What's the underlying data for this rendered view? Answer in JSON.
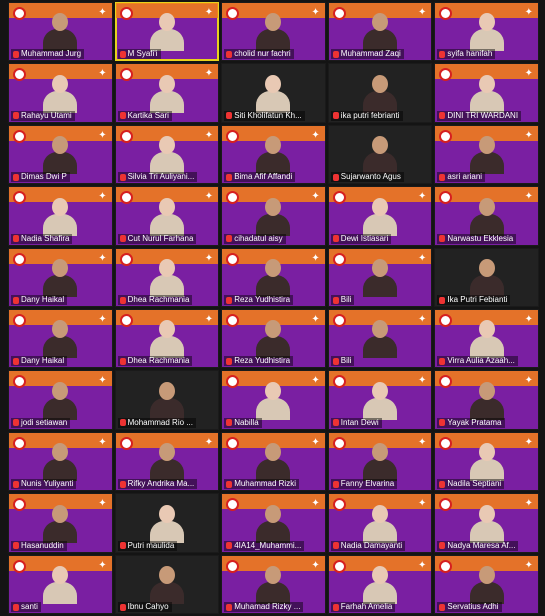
{
  "participants": [
    {
      "name": "Muhammad Jurg",
      "hijab": false,
      "dark": false
    },
    {
      "name": "M Syafi'i",
      "hijab": true,
      "dark": false,
      "active": true
    },
    {
      "name": "cholid nur fachri",
      "hijab": false,
      "dark": false
    },
    {
      "name": "Muhammad Zaqi",
      "hijab": false,
      "dark": false
    },
    {
      "name": "syifa hanifah",
      "hijab": true,
      "dark": false
    },
    {
      "name": "Rahayu Utami",
      "hijab": true,
      "dark": false
    },
    {
      "name": "Kartika Sari",
      "hijab": true,
      "dark": false
    },
    {
      "name": "Siti Kholifatun Kh...",
      "hijab": true,
      "dark": true
    },
    {
      "name": "ika putri febrianti",
      "hijab": false,
      "dark": true
    },
    {
      "name": "DINI TRI WARDANI",
      "hijab": true,
      "dark": false
    },
    {
      "name": "Dimas Dwi P",
      "hijab": false,
      "dark": false
    },
    {
      "name": "Silvia Tri Auliyani...",
      "hijab": true,
      "dark": false
    },
    {
      "name": "Bima Afif Affandi",
      "hijab": false,
      "dark": false
    },
    {
      "name": "Sujarwanto Agus",
      "hijab": false,
      "dark": true
    },
    {
      "name": "asri ariani",
      "hijab": false,
      "dark": false
    },
    {
      "name": "Nadia Shafira",
      "hijab": true,
      "dark": false
    },
    {
      "name": "Cut Nurul Farhana",
      "hijab": true,
      "dark": false
    },
    {
      "name": "cihadatul aisy",
      "hijab": false,
      "dark": false
    },
    {
      "name": "Dewi Istiasari",
      "hijab": true,
      "dark": false
    },
    {
      "name": "Narwastu Ekklesia",
      "hijab": false,
      "dark": false
    },
    {
      "name": "Dany Haikal",
      "hijab": false,
      "dark": false
    },
    {
      "name": "Dhea Rachmania",
      "hijab": true,
      "dark": false
    },
    {
      "name": "Reza Yudhistira",
      "hijab": false,
      "dark": false
    },
    {
      "name": "Bili",
      "hijab": false,
      "dark": false
    },
    {
      "name": "Ika Putri Febianti",
      "hijab": false,
      "dark": true
    },
    {
      "name": "Dany Haikal",
      "hijab": false,
      "dark": false
    },
    {
      "name": "Dhea Rachmania",
      "hijab": true,
      "dark": false
    },
    {
      "name": "Reza Yudhistira",
      "hijab": false,
      "dark": false
    },
    {
      "name": "Bili",
      "hijab": false,
      "dark": false
    },
    {
      "name": "Virra Aulia Azaah...",
      "hijab": true,
      "dark": false
    },
    {
      "name": "jodi setiawan",
      "hijab": false,
      "dark": false
    },
    {
      "name": "Mohammad Rio ...",
      "hijab": false,
      "dark": true
    },
    {
      "name": "Nabilla",
      "hijab": true,
      "dark": false
    },
    {
      "name": "Intan Dewi",
      "hijab": true,
      "dark": false
    },
    {
      "name": "Yayak Pratama",
      "hijab": false,
      "dark": false
    },
    {
      "name": "Nunis Yuliyanti",
      "hijab": false,
      "dark": false
    },
    {
      "name": "Rifky Andrika Ma...",
      "hijab": false,
      "dark": false
    },
    {
      "name": "Muhammad Rizki",
      "hijab": false,
      "dark": false
    },
    {
      "name": "Fanny Elvarina",
      "hijab": false,
      "dark": false
    },
    {
      "name": "Nadila Septiani",
      "hijab": true,
      "dark": false
    },
    {
      "name": "Hasanuddin",
      "hijab": false,
      "dark": false
    },
    {
      "name": "Putri maulida",
      "hijab": true,
      "dark": true
    },
    {
      "name": "4IA14_Muhammi...",
      "hijab": false,
      "dark": false
    },
    {
      "name": "Nadia Damayanti",
      "hijab": true,
      "dark": false
    },
    {
      "name": "Nadya Maresa Af...",
      "hijab": true,
      "dark": false
    },
    {
      "name": "santi",
      "hijab": true,
      "dark": false
    },
    {
      "name": "Ibnu Cahyo",
      "hijab": false,
      "dark": true
    },
    {
      "name": "Muhamad Rizky ...",
      "hijab": false,
      "dark": false
    },
    {
      "name": "Farhah Amelia",
      "hijab": true,
      "dark": false
    },
    {
      "name": "Servatius Adhi",
      "hijab": false,
      "dark": false
    }
  ],
  "colors": {
    "background": "#7a1fa2",
    "banner": "#f07b1c",
    "active_speaker": "#e8d21d"
  }
}
